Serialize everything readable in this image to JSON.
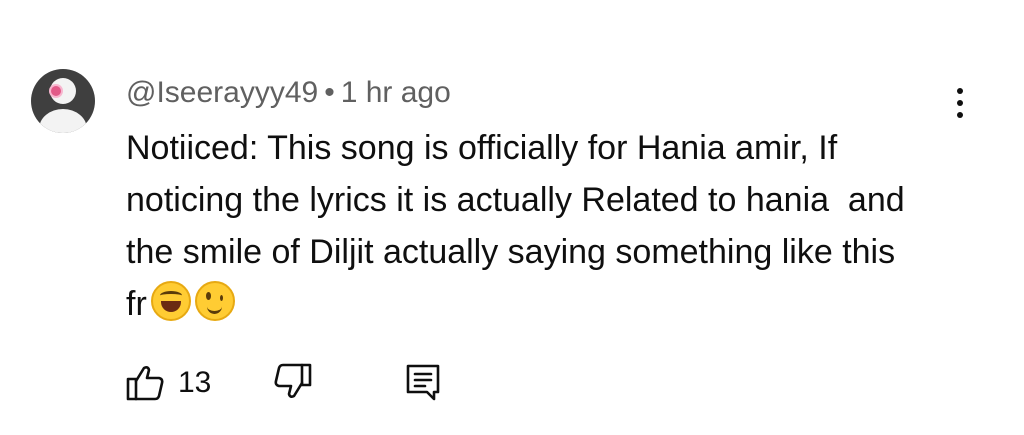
{
  "comment": {
    "author": "@Iseerayyy49",
    "separator": "•",
    "time": "1 hr ago",
    "text_lines": [
      "Notiiced: This song is officially for Hania amir, If",
      "noticing the lyrics it is actually Related to hania  and",
      "the smile of Diljit actually saying something like this",
      "fr"
    ],
    "emojis": [
      "laughing-squint-emoji",
      "wink-emoji"
    ]
  },
  "actions": {
    "like_count": "13",
    "like_icon": "thumbs-up-icon",
    "dislike_icon": "thumbs-down-icon",
    "reply_icon": "reply-comment-icon"
  },
  "menu": {
    "icon": "more-vertical-icon"
  }
}
